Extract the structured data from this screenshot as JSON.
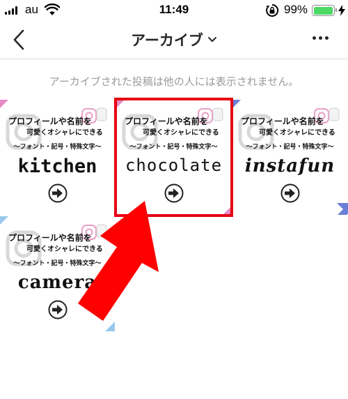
{
  "status_bar": {
    "carrier": "au",
    "time": "11:49",
    "battery_percent": "99%",
    "battery_level": 0.99,
    "battery_color": "#4cd964"
  },
  "header": {
    "title": "アーカイブ",
    "back_icon": "chevron-left-icon",
    "title_dropdown_icon": "chevron-down-icon",
    "more_icon": "more-dots-icon"
  },
  "notice": "アーカイブされた投稿は他の人には表示されません。",
  "posts": [
    {
      "line1": "プロフィールや名前を",
      "line2": "可愛くオシャレにできる",
      "line3": "〜フォント・記号・特殊文字〜",
      "word": "kitchen",
      "corner_color": "#e68ac6"
    },
    {
      "line1": "プロフィールや名前を",
      "line2": "可愛くオシャレにできる",
      "line3": "〜フォント・記号・特殊文字〜",
      "word": "chocolate",
      "corner_color": "#e68ac6"
    },
    {
      "line1": "プロフィールや名前を",
      "line2": "可愛くオシャレにできる",
      "line3": "〜フォント・記号・特殊文字〜",
      "word": "instafun",
      "corner_color": "#6b7fd6"
    },
    {
      "line1": "プロフィールや名前を",
      "line2": "可愛くオシャレにできる",
      "line3": "〜フォント・記号・特殊文字〜",
      "word": "camera",
      "corner_color": "#9ac8ec"
    }
  ],
  "annotation": {
    "highlight_color": "#e60012",
    "arrow_color": "#ff0000"
  }
}
